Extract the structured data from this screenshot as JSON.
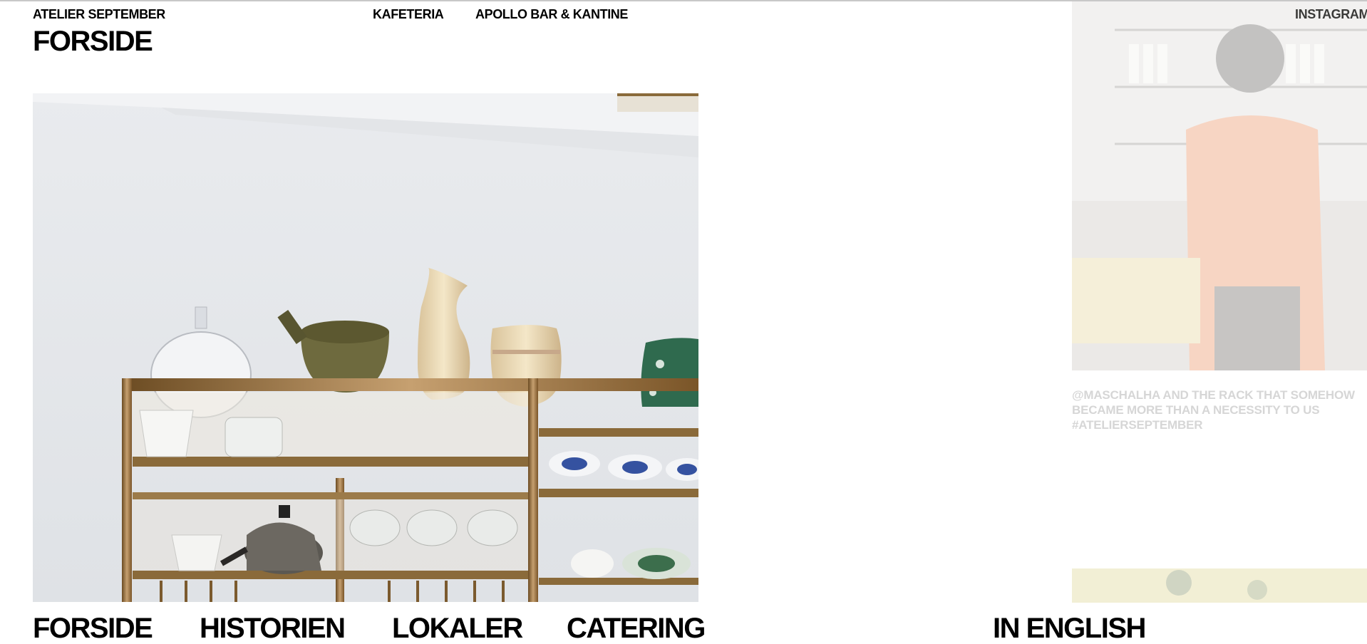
{
  "header": {
    "brand": "ATELIER SEPTEMBER",
    "page_title": "FORSIDE",
    "nav": [
      {
        "label": "KAFETERIA"
      },
      {
        "label": "APOLLO BAR & KANTINE"
      }
    ],
    "instagram": "INSTAGRAM"
  },
  "instagram_post": {
    "caption": "@MASCHALHA AND THE RACK THAT SOMEHOW BECAME MORE THAN A NECESSITY TO US #ATELIERSEPTEMBER"
  },
  "footer_nav": [
    {
      "label": "FORSIDE"
    },
    {
      "label": "HISTORIEN"
    },
    {
      "label": "LOKALER"
    },
    {
      "label": "CATERING"
    }
  ],
  "language_link": "IN ENGLISH",
  "colors": {
    "text": "#000000",
    "background": "#ffffff",
    "faded_caption": "#d6d6d6"
  }
}
